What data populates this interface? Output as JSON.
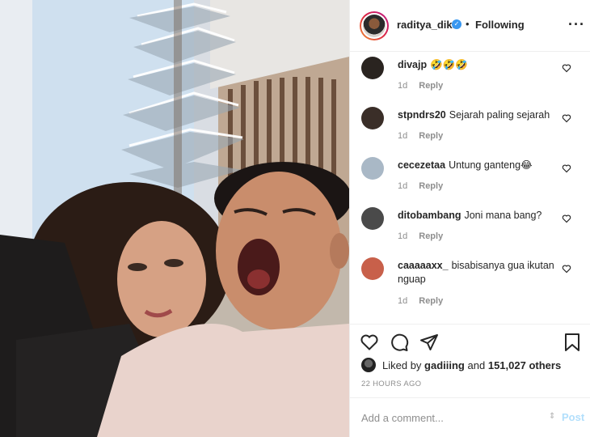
{
  "post": {
    "username": "raditya_dika",
    "verified_mark": "✓",
    "separator": "•",
    "follow_status": "Following",
    "more_icon": "more-options-icon"
  },
  "comments": [
    {
      "user": "divajp",
      "text": "🤣🤣🤣",
      "time": "1d",
      "reply": "Reply",
      "avatar_color": "#2a2420"
    },
    {
      "user": "stpndrs20",
      "text": "Sejarah paling sejarah",
      "time": "1d",
      "reply": "Reply",
      "avatar_color": "#3a2e28"
    },
    {
      "user": "cecezetaa",
      "text": "Untung ganteng😂",
      "time": "1d",
      "reply": "Reply",
      "avatar_color": "#a9b8c6"
    },
    {
      "user": "ditobambang",
      "text": "Joni mana bang?",
      "time": "1d",
      "reply": "Reply",
      "avatar_color": "#4a4a4a"
    },
    {
      "user": "caaaaaxx_",
      "text": "bisabisanya gua ikutan nguap",
      "time": "1d",
      "reply": "Reply",
      "avatar_color": "#c8604a"
    }
  ],
  "actions": {
    "like_icon": "heart-outline-icon",
    "comment_icon": "comment-bubble-icon",
    "share_icon": "paper-plane-icon",
    "save_icon": "bookmark-icon"
  },
  "likes": {
    "prefix": "Liked by",
    "user": "gadiiing",
    "conjunction": "and",
    "count": "151,027 others"
  },
  "time_ago": "22 HOURS AGO",
  "add_comment": {
    "placeholder": "Add a comment...",
    "post_label": "Post"
  },
  "colors": {
    "accent": "#3897f0",
    "post_disabled": "#b2dffc",
    "meta_text": "#8e8e8e"
  }
}
